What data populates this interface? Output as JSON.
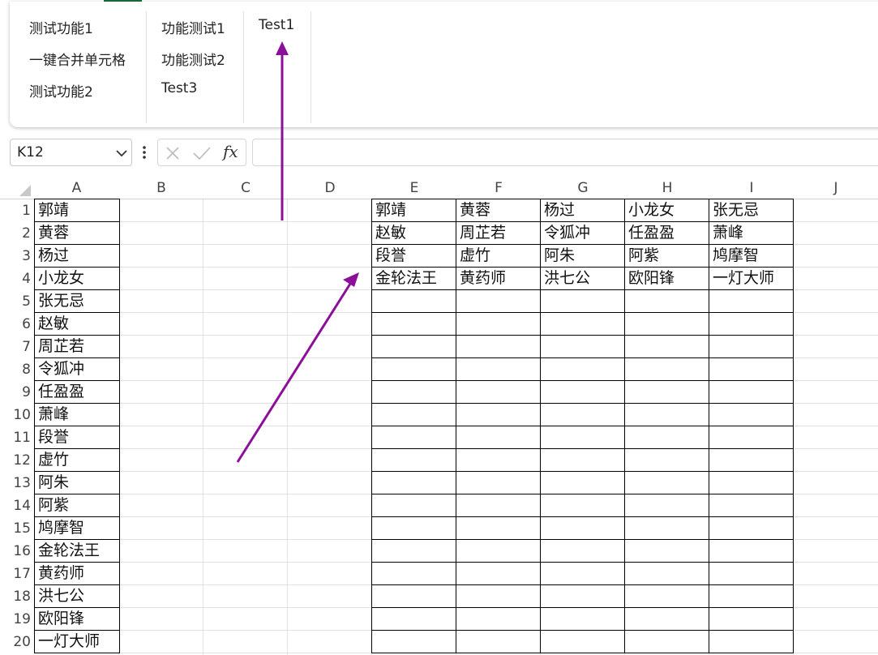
{
  "ribbon": {
    "group1": [
      "测试功能1",
      "一键合并单元格",
      "测试功能2"
    ],
    "group2": [
      "功能测试1",
      "功能测试2",
      "Test3"
    ],
    "group3": [
      "Test1"
    ]
  },
  "formula_bar": {
    "name_box": "K12",
    "fx_label": "fx",
    "formula_value": ""
  },
  "sheet": {
    "columns": [
      "A",
      "B",
      "C",
      "D",
      "E",
      "F",
      "G",
      "H",
      "I",
      "J"
    ],
    "rows": [
      "1",
      "2",
      "3",
      "4",
      "5",
      "6",
      "7",
      "8",
      "9",
      "10",
      "11",
      "12",
      "13",
      "14",
      "15",
      "16",
      "17",
      "18",
      "19",
      "20"
    ],
    "column_a": [
      "郭靖",
      "黄蓉",
      "杨过",
      "小龙女",
      "张无忌",
      "赵敏",
      "周芷若",
      "令狐冲",
      "任盈盈",
      "萧峰",
      "段誉",
      "虚竹",
      "阿朱",
      "阿紫",
      "鸠摩智",
      "金轮法王",
      "黄药师",
      "洪七公",
      "欧阳锋",
      "一灯大师"
    ],
    "e_to_i": [
      [
        "郭靖",
        "黄蓉",
        "杨过",
        "小龙女",
        "张无忌"
      ],
      [
        "赵敏",
        "周芷若",
        "令狐冲",
        "任盈盈",
        "萧峰"
      ],
      [
        "段誉",
        "虚竹",
        "阿朱",
        "阿紫",
        "鸠摩智"
      ],
      [
        "金轮法王",
        "黄药师",
        "洪七公",
        "欧阳锋",
        "一灯大师"
      ]
    ]
  },
  "colors": {
    "annotation_arrow": "#8b0f99",
    "accent": "#1e6b3a"
  }
}
